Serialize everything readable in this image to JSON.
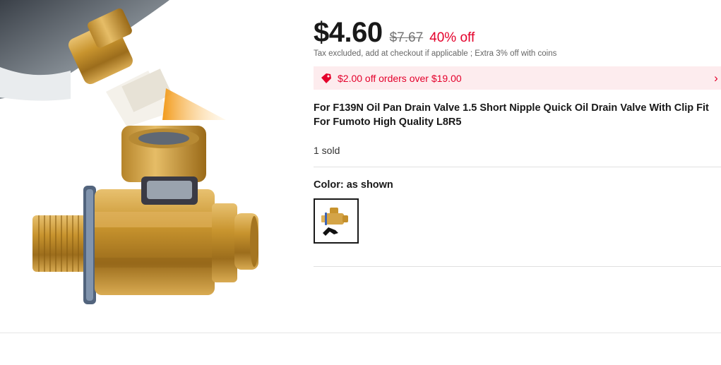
{
  "price": {
    "current": "$4.60",
    "original": "$7.67",
    "discount": "40% off"
  },
  "tax_note": "Tax excluded, add at checkout if applicable ; Extra 3% off with coins",
  "coupon": {
    "text": "$2.00 off orders over $19.00",
    "icon": "tag-icon",
    "chevron": "›"
  },
  "product": {
    "title": "For F139N Oil Pan Drain Valve 1.5 Short Nipple Quick Oil Drain Valve With Clip Fit For Fumoto High Quality L8R5",
    "sold": "1 sold"
  },
  "variant": {
    "label": "Color:",
    "value": "as shown",
    "swatches": [
      "as shown"
    ]
  },
  "colors": {
    "accent": "#e4002b",
    "coupon_bg": "#fdecee",
    "brass": "#c89a3a"
  }
}
